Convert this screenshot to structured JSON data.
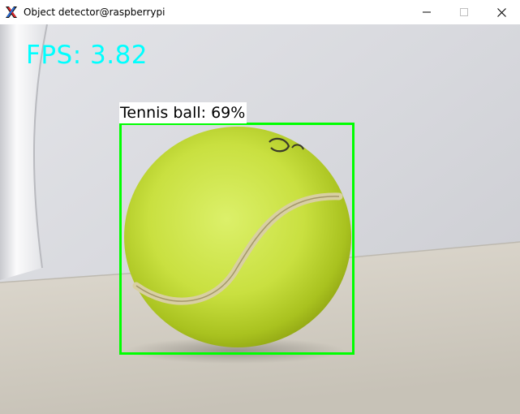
{
  "window": {
    "title": "Object detector@raspberrypi",
    "app_icon": "x11-icon",
    "controls": {
      "minimize": "minimize-icon",
      "maximize": "maximize-icon",
      "close": "close-icon"
    }
  },
  "overlay": {
    "fps_text": "FPS: 3.82",
    "fps_color": "#00ffff",
    "detection": {
      "label": "Tennis ball: 69%",
      "box_color": "#00ff00"
    }
  }
}
